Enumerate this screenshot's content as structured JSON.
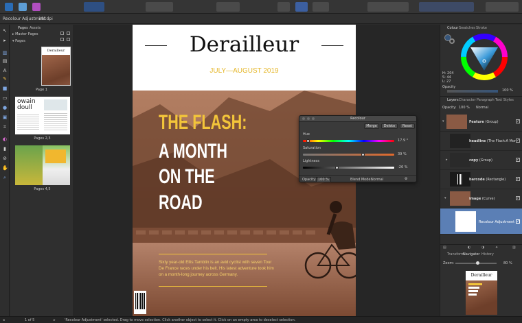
{
  "context_bar": {
    "selection": "Recolour Adjustment",
    "dpi": "181dpi"
  },
  "pages_panel": {
    "tabs": [
      "Pages",
      "Assets"
    ],
    "rows": [
      "Master Pages",
      "Pages"
    ],
    "thumb2_title": "owain doull",
    "labels": [
      "Page 1",
      "Pages 2,3",
      "Pages 4,5"
    ]
  },
  "document": {
    "title": "Derailleur",
    "date": "JULY—AUGUST 2019",
    "headline": [
      "THE FLASH:",
      "A MONTH",
      "ON THE",
      "ROAD"
    ],
    "blurb": "Sixty year-old Ellis Tamblin is an avid cyclist with seven Tour De France races under his belt. His latest adventure took him on a month-long journey across Germany."
  },
  "recolour": {
    "title": "Recolour",
    "buttons": [
      "Merge",
      "Delete",
      "Reset"
    ],
    "hue": {
      "label": "Hue",
      "value": "17.9 °",
      "level": 0.06
    },
    "saturation": {
      "label": "Saturation",
      "value": "39 %",
      "level": 0.66
    },
    "lightness": {
      "label": "Lightness",
      "value": "-26 %",
      "level": 0.37
    },
    "opacity_label": "Opacity:",
    "opacity_value": "100 %",
    "blend_label": "Blend Mode:",
    "blend_value": "Normal"
  },
  "colour_panel": {
    "tabs": [
      "Colour",
      "Swatches",
      "Stroke"
    ],
    "readout": [
      "H: 204",
      "S: 44",
      "L: 27"
    ],
    "opacity_label": "Opacity",
    "opacity_value": "100 %"
  },
  "layers_panel": {
    "tabs": [
      "Layers",
      "Character",
      "Paragraph",
      "Text Styles"
    ],
    "opacity_label": "Opacity:",
    "opacity_value": "100 %",
    "blend_value": "Normal",
    "layers": [
      {
        "name": "Feature",
        "kind": "(Group)"
      },
      {
        "name": "headline",
        "kind": "(The Flash:A Mon"
      },
      {
        "name": "copy",
        "kind": "(Group)"
      },
      {
        "name": "barcode",
        "kind": "(Rectangle)"
      },
      {
        "name": "image",
        "kind": "(Curve)"
      },
      {
        "name": "Recolour Adjustment",
        "kind": ""
      }
    ]
  },
  "navigator": {
    "tabs": [
      "Transform",
      "Navigator",
      "History"
    ],
    "zoom_label": "Zoom:",
    "zoom_value": "80 %",
    "thumb_title": "Derailleur"
  },
  "status": {
    "page": "1 of 5",
    "message": "'Recolour Adjustment' selected. Drag to move selection. Click another object to select it. Click on an empty area to deselect selection."
  },
  "colors": {
    "accent_yellow": "#f3c53a",
    "panel_bg": "#2f2f2f",
    "selection_blue": "#5b7fb5"
  }
}
